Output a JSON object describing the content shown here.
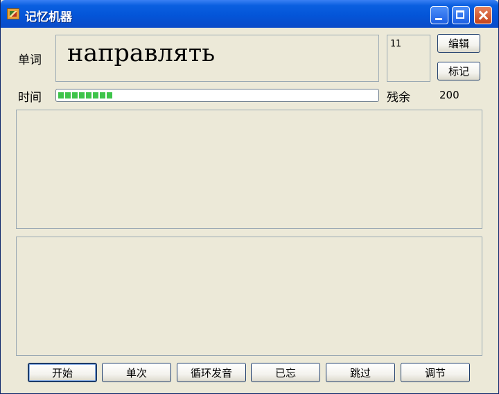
{
  "window": {
    "title": "记忆机器"
  },
  "word": {
    "label": "单词",
    "value": "направлять",
    "count": "11"
  },
  "time": {
    "label": "时间",
    "progress_percent": 17
  },
  "remaining": {
    "label": "残余",
    "value": "200"
  },
  "side_buttons": {
    "edit": "编辑",
    "mark": "标记"
  },
  "bottom_buttons": {
    "start": "开始",
    "single": "单次",
    "loop_sound": "循环发音",
    "forgot": "已忘",
    "skip": "跳过",
    "adjust": "调节"
  },
  "colors": {
    "title_bar": "#0455d8",
    "progress_fill": "#3ec44a",
    "background": "#ece9d8"
  }
}
